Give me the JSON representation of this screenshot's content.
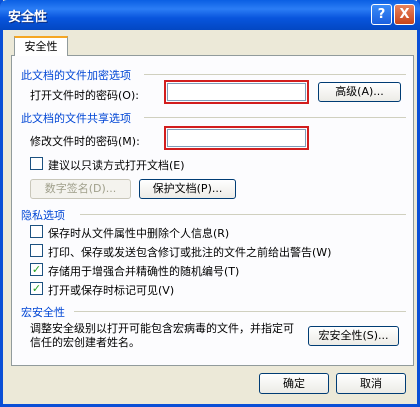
{
  "window": {
    "title": "安全性",
    "help_icon": "?",
    "close_icon": "X"
  },
  "tab": {
    "label": "安全性"
  },
  "encrypt_group": {
    "title": "此文档的文件加密选项",
    "open_password_label": "打开文件时的密码(O):",
    "open_password_value": "",
    "advanced_button": "高级(A)..."
  },
  "share_group": {
    "title": "此文档的文件共享选项",
    "modify_password_label": "修改文件时的密码(M):",
    "modify_password_value": "",
    "readonly_label": "建议以只读方式打开文档(E)",
    "readonly_checked": false,
    "digital_signature_button": "数字签名(D)...",
    "protect_document_button": "保护文档(P)..."
  },
  "privacy_group": {
    "title": "隐私选项",
    "items": [
      {
        "label": "保存时从文件属性中删除个人信息(R)",
        "checked": false
      },
      {
        "label": "打印、保存或发送包含修订或批注的文件之前给出警告(W)",
        "checked": false
      },
      {
        "label": "存储用于增强合并精确性的随机编号(T)",
        "checked": true
      },
      {
        "label": "打开或保存时标记可见(V)",
        "checked": true
      }
    ]
  },
  "macro_group": {
    "title": "宏安全性",
    "description": "调整安全级别以打开可能包含宏病毒的文件，并指定可信任的宏创建者姓名。",
    "macro_button": "宏安全性(S)..."
  },
  "footer": {
    "ok_button": "确定",
    "cancel_button": "取消"
  }
}
